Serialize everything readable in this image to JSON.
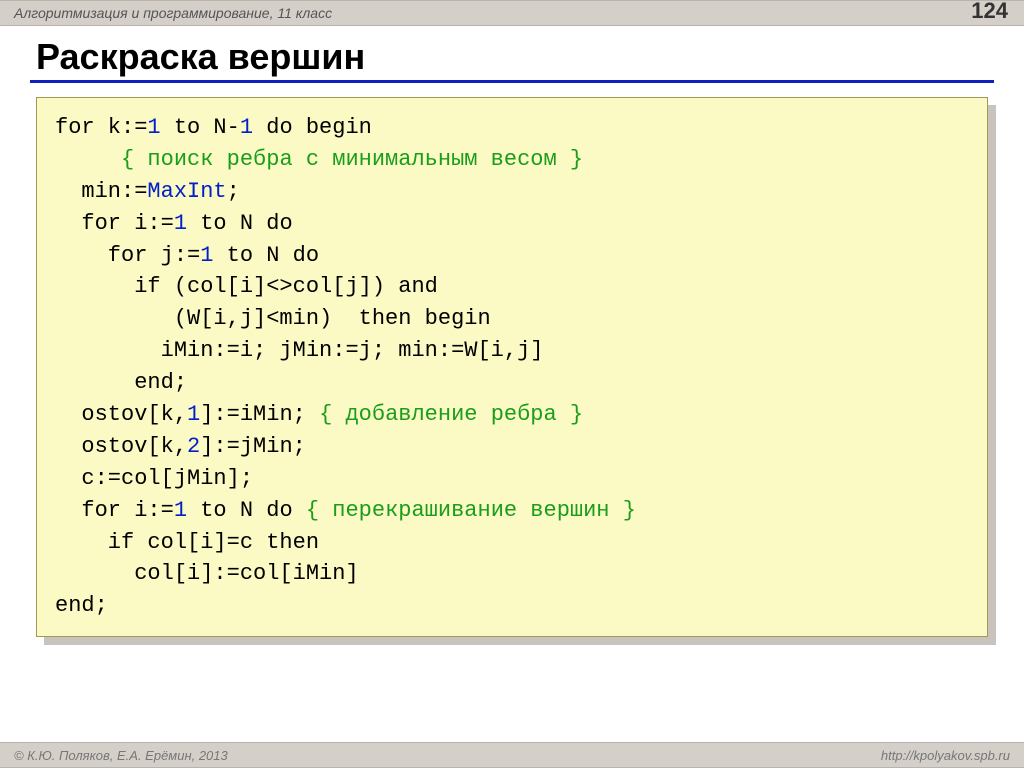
{
  "header": {
    "breadcrumb": "Алгоритмизация и программирование, 11 класс",
    "page_number": "124"
  },
  "title": "Раскраска вершин",
  "code": {
    "l1": {
      "a": "for k:=",
      "n1": "1",
      "b": " to N-",
      "n2": "1",
      "c": " do begin"
    },
    "l2": {
      "cmt": "{ поиск ребра с минимальным весом }"
    },
    "l3": {
      "a": "  min:=",
      "id": "MaxInt",
      "b": ";"
    },
    "l4": {
      "a": "  for i:=",
      "n1": "1",
      "b": " to N do"
    },
    "l5": {
      "a": "    for j:=",
      "n1": "1",
      "b": " to N do"
    },
    "l6": {
      "a": "      if (col[i]<>col[j]) and"
    },
    "l7": {
      "a": "         (W[i,j]<min)  then begin"
    },
    "l8": {
      "a": "        iMin:=i; jMin:=j; min:=W[i,j]"
    },
    "l9": {
      "a": "      end;"
    },
    "l10": {
      "a": "  ostov[k,",
      "n1": "1",
      "b": "]:=iMin; ",
      "cmt": "{ добавление ребра }"
    },
    "l11": {
      "a": "  ostov[k,",
      "n1": "2",
      "b": "]:=jMin;"
    },
    "l12": {
      "a": "  c:=col[jMin];"
    },
    "l13": {
      "a": "  for i:=",
      "n1": "1",
      "b": " to N do ",
      "cmt": "{ перекрашивание вершин }"
    },
    "l14": {
      "a": "    if col[i]=c then"
    },
    "l15": {
      "a": "      col[i]:=col[iMin]"
    },
    "l16": {
      "a": "end;"
    }
  },
  "footer": {
    "left": "© К.Ю. Поляков, Е.А. Ерёмин, 2013",
    "right": "http://kpolyakov.spb.ru"
  }
}
